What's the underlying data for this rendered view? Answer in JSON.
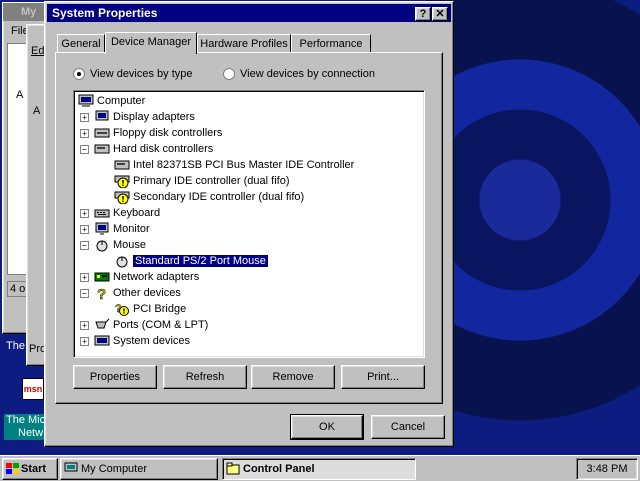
{
  "dialog": {
    "title": "System Properties",
    "help_glyph": "?",
    "close_glyph": "✕",
    "tabs": [
      {
        "label": "General"
      },
      {
        "label": "Device Manager",
        "active": true
      },
      {
        "label": "Hardware Profiles"
      },
      {
        "label": "Performance"
      }
    ],
    "radio_by_type": "View devices by type",
    "radio_by_connection": "View devices by connection",
    "selected_view": "type",
    "tree": [
      {
        "label": "Computer",
        "icon": "computer-icon"
      },
      {
        "label": "Display adapters",
        "icon": "display-adapter-icon",
        "expander": "+"
      },
      {
        "label": "Floppy disk controllers",
        "icon": "floppy-controller-icon",
        "expander": "+"
      },
      {
        "label": "Hard disk controllers",
        "icon": "hard-disk-controller-icon",
        "expander": "−"
      },
      {
        "label": "Intel 82371SB PCI Bus Master IDE Controller",
        "icon": "ide-controller-icon"
      },
      {
        "label": "Primary IDE controller (dual fifo)",
        "icon": "warning-controller-icon"
      },
      {
        "label": "Secondary IDE controller (dual fifo)",
        "icon": "warning-controller-icon"
      },
      {
        "label": "Keyboard",
        "icon": "keyboard-icon",
        "expander": "+"
      },
      {
        "label": "Monitor",
        "icon": "monitor-icon",
        "expander": "+"
      },
      {
        "label": "Mouse",
        "icon": "mouse-icon",
        "expander": "−"
      },
      {
        "label": "Standard PS/2 Port Mouse",
        "icon": "mouse-icon",
        "selected": true
      },
      {
        "label": "Network adapters",
        "icon": "network-adapter-icon",
        "expander": "+"
      },
      {
        "label": "Other devices",
        "icon": "question-icon",
        "expander": "−"
      },
      {
        "label": "PCI Bridge",
        "icon": "warning-question-icon"
      },
      {
        "label": "Ports (COM & LPT)",
        "icon": "port-icon",
        "expander": "+"
      },
      {
        "label": "System devices",
        "icon": "system-devices-icon",
        "expander": "+"
      }
    ],
    "buttons": {
      "properties": "Properties",
      "refresh": "Refresh",
      "remove": "Remove",
      "print": "Print...",
      "ok": "OK",
      "cancel": "Cancel"
    }
  },
  "background": {
    "window_title": "My",
    "menu_file": "File",
    "menu_edit": "Edi",
    "status": "4 o",
    "label_a1": "A",
    "label_a2": "A",
    "label_pro": "Pro",
    "desktop_icon_1": "The",
    "desktop_icon_2_line1": "The Mic",
    "desktop_icon_2_line2": "Netw",
    "msn_logo": "msn"
  },
  "taskbar": {
    "start": "Start",
    "tasks": [
      {
        "label": "My Computer",
        "active": false
      },
      {
        "label": "Control Panel",
        "active": true
      }
    ],
    "clock": "3:48 PM"
  },
  "colors": {
    "titlebar": "#000080",
    "selection": "#000080",
    "face": "#c0c0c0"
  }
}
